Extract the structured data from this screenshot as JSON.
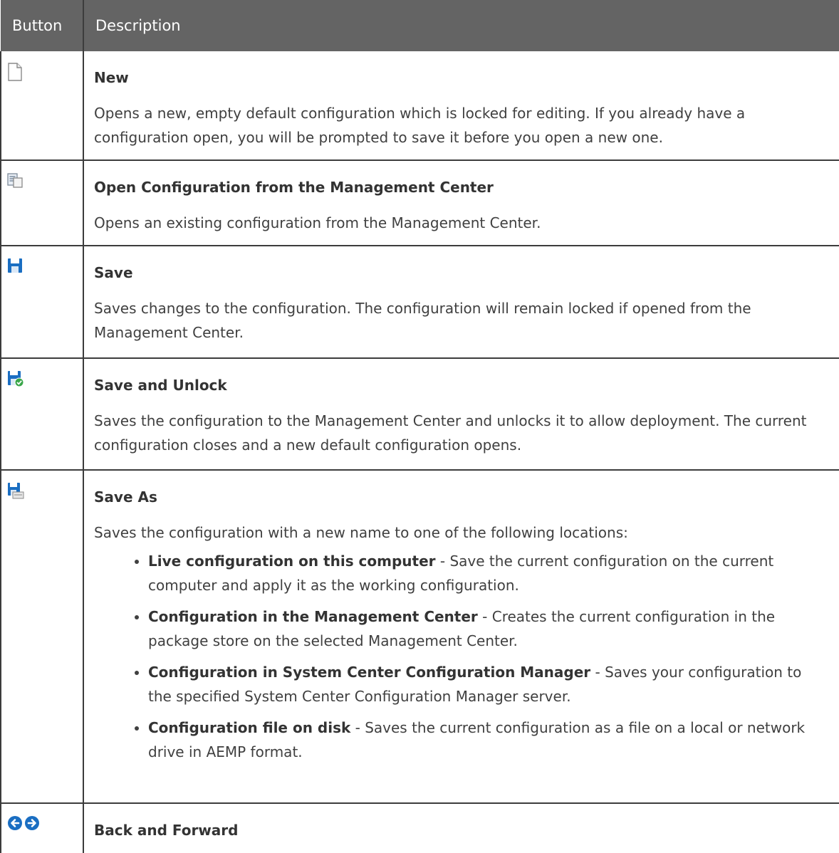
{
  "table": {
    "headers": {
      "button": "Button",
      "description": "Description"
    },
    "rows": [
      {
        "icon": "new-document-icon",
        "title": "New",
        "description": "Opens a new, empty default configuration which is locked for editing. If you already have a configuration open, you will be prompted to save it before you open a new one."
      },
      {
        "icon": "open-configuration-icon",
        "title": "Open Configuration from the Management Center",
        "description": "Opens an existing configuration from the Management Center."
      },
      {
        "icon": "save-icon",
        "title": "Save",
        "description": "Saves changes to the configuration. The configuration will remain locked if opened from the Management Center."
      },
      {
        "icon": "save-and-unlock-icon",
        "title": "Save and Unlock",
        "description": "Saves the configuration to the Management Center and unlocks it to allow deployment. The current configuration closes and a new default configuration opens."
      },
      {
        "icon": "save-as-icon",
        "title": "Save As",
        "description": "Saves the configuration with a new name to one of the following locations:",
        "locations": [
          {
            "name": "Live configuration on this computer",
            "text": " - Save the current configuration on the current computer and apply it as the working configuration."
          },
          {
            "name": "Configuration in the Management Center",
            "text": " - Creates the current configuration in the package store on the selected Management Center."
          },
          {
            "name": "Configuration in System Center Configuration Manager",
            "text": " - Saves your configuration to the specified System Center Configuration Manager server."
          },
          {
            "name": "Configuration file on disk",
            "text": " - Saves the current configuration as a file on a local or network drive in AEMP format."
          }
        ]
      },
      {
        "icon": "back-forward-icon",
        "title": "Back and Forward"
      }
    ]
  },
  "colors": {
    "header_background": "#646464",
    "header_text": "#ffffff",
    "border": "#3c3c3c",
    "icon_blue": "#1a6ec2",
    "icon_green": "#3aa64a"
  }
}
